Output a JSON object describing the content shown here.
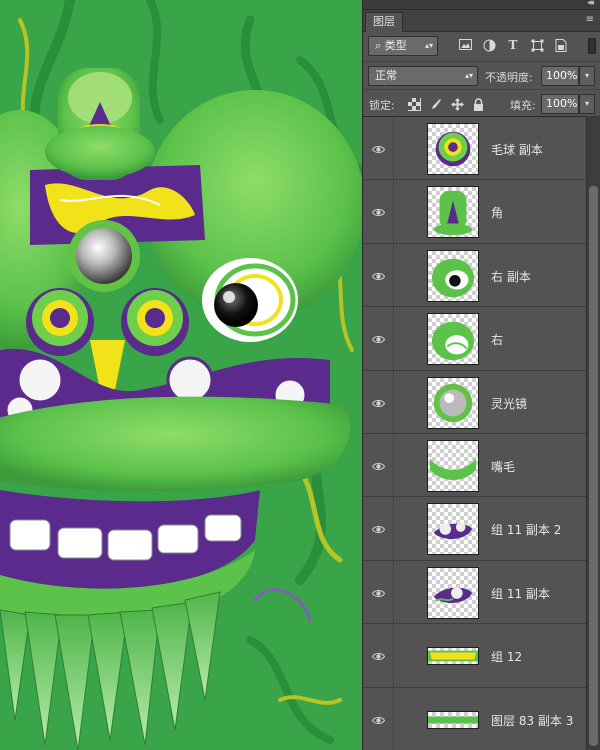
{
  "panel": {
    "collapse_glyph": "◂◂",
    "tab_label": "图层",
    "menu_glyph": "≡",
    "filter": {
      "kind_label": "类型",
      "search_glyph": "⌕"
    },
    "blend_mode": "正常",
    "opacity_label": "不透明度:",
    "opacity_value": "100%",
    "lock_label": "锁定:",
    "fill_label": "填充:",
    "fill_value": "100%"
  },
  "layers": [
    {
      "name": "毛球 副本",
      "visible": true,
      "thumb": "pompom"
    },
    {
      "name": "角",
      "visible": true,
      "thumb": "horn"
    },
    {
      "name": "右 副本",
      "visible": true,
      "thumb": "right-eye-copy"
    },
    {
      "name": "右",
      "visible": true,
      "thumb": "right-eye"
    },
    {
      "name": "灵光镜",
      "visible": true,
      "thumb": "mirror"
    },
    {
      "name": "嘴毛",
      "visible": true,
      "thumb": "mouth-fur"
    },
    {
      "name": "组 11 副本 2",
      "visible": true,
      "thumb": "group-purple"
    },
    {
      "name": "组 11 副本",
      "visible": true,
      "thumb": "group-purple-2"
    },
    {
      "name": "组 12",
      "visible": true,
      "thumb": "teeth-strip"
    },
    {
      "name": "图层 83 副本 3",
      "visible": true,
      "thumb": "green-strip"
    }
  ],
  "colors": {
    "lion_green": "#5cc24a",
    "background_green": "#39a548",
    "purple": "#5a2a8c",
    "yellow": "#f2e21a"
  }
}
